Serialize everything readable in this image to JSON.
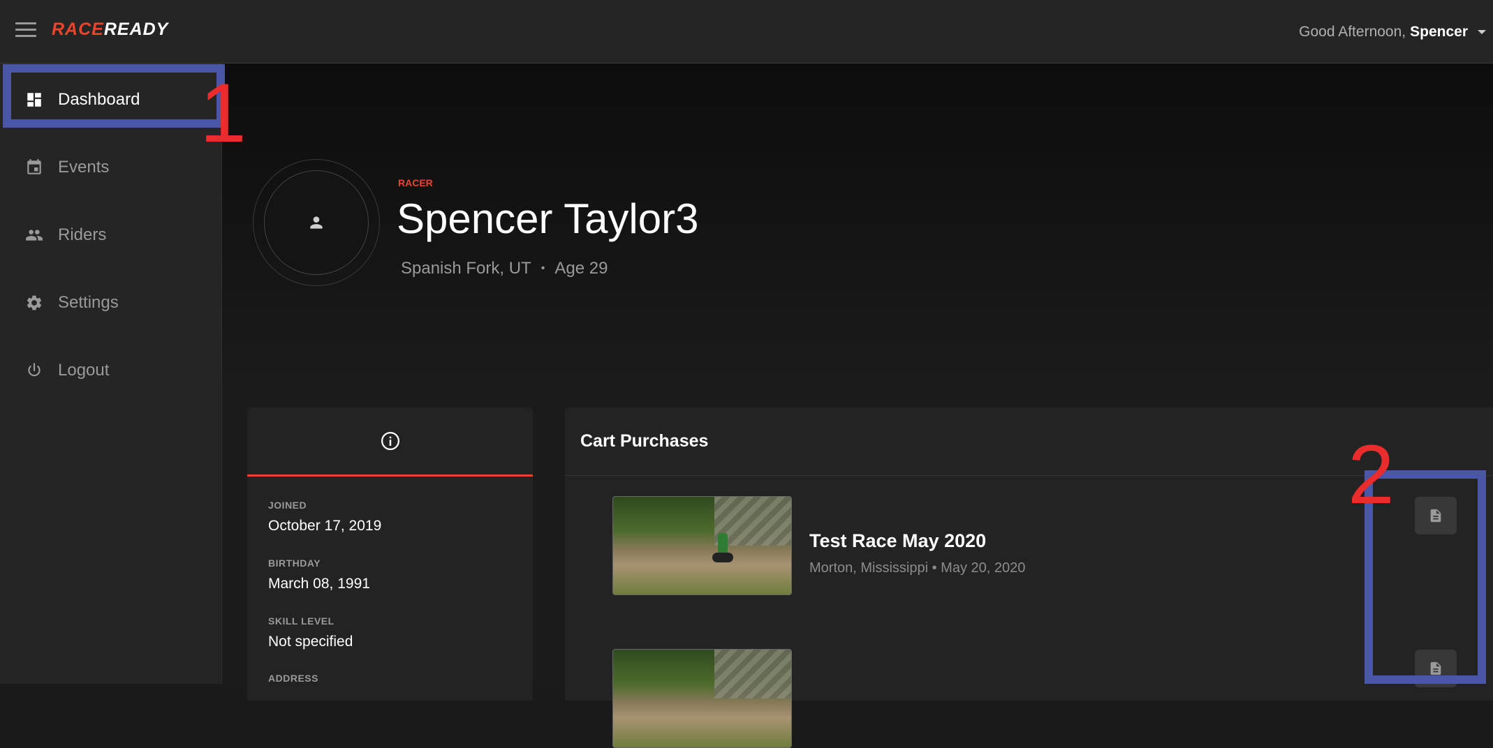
{
  "header": {
    "logo_left": "RACE",
    "logo_right": "READY",
    "greeting": "Good Afternoon,",
    "username": "Spencer"
  },
  "sidebar": {
    "items": [
      {
        "label": "Dashboard",
        "icon": "dashboard-icon",
        "active": true
      },
      {
        "label": "Events",
        "icon": "calendar-icon"
      },
      {
        "label": "Riders",
        "icon": "people-icon"
      },
      {
        "label": "Settings",
        "icon": "gear-icon"
      },
      {
        "label": "Logout",
        "icon": "power-icon"
      }
    ]
  },
  "profile": {
    "role": "RACER",
    "name": "Spencer Taylor3",
    "location": "Spanish Fork, UT",
    "separator": "•",
    "age": "Age 29"
  },
  "info": {
    "tab_icon": "info-icon",
    "fields": [
      {
        "label": "JOINED",
        "value": "October 17, 2019"
      },
      {
        "label": "BIRTHDAY",
        "value": "March 08, 1991"
      },
      {
        "label": "SKILL LEVEL",
        "value": "Not specified"
      },
      {
        "label": "ADDRESS",
        "value": ""
      }
    ]
  },
  "cart": {
    "title": "Cart Purchases",
    "items": [
      {
        "title": "Test Race May 2020",
        "subtitle": "Morton, Mississippi • May 20, 2020",
        "action_icon": "document-icon"
      },
      {
        "title": "",
        "subtitle": "",
        "action_icon": "document-icon"
      }
    ]
  },
  "annotations": [
    "1",
    "2"
  ],
  "colors": {
    "accent": "#e8452c",
    "annotation_box": "#4a57a8",
    "annotation_number": "#ea2c2c"
  }
}
